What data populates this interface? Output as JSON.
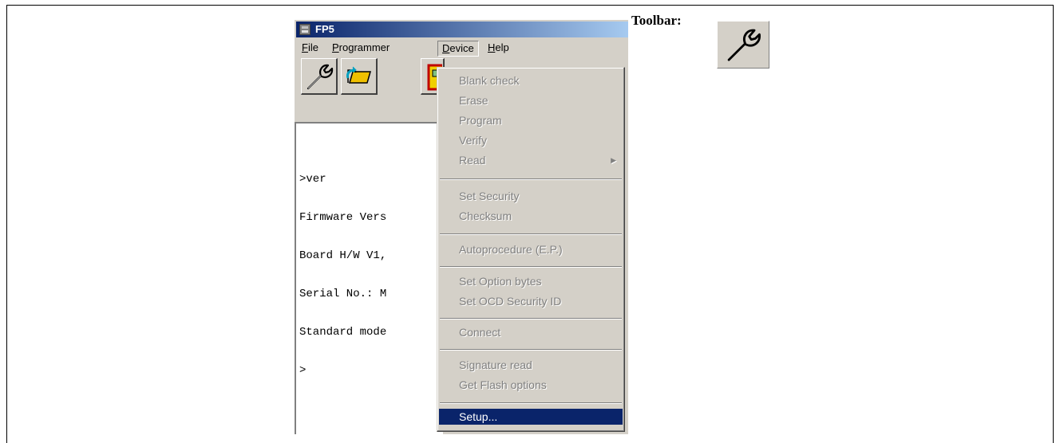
{
  "window": {
    "title": "FP5"
  },
  "menubar": [
    {
      "label": "File",
      "mnemonic": "F"
    },
    {
      "label": "Programmer",
      "mnemonic": "P"
    },
    {
      "label": "Device",
      "mnemonic": "D"
    },
    {
      "label": "Help",
      "mnemonic": "H"
    }
  ],
  "toolbar": {
    "icons": [
      "wrench-icon",
      "open-folder-icon",
      "device-program-icon"
    ]
  },
  "console": {
    "lines": [
      ">ver",
      "Firmware Vers",
      "Board H/W V1,",
      "Serial No.: M",
      "Standard mode",
      ">"
    ]
  },
  "device_menu": {
    "items": [
      {
        "label": "Blank check",
        "enabled": false
      },
      {
        "label": "Erase",
        "enabled": false
      },
      {
        "label": "Program",
        "enabled": false
      },
      {
        "label": "Verify",
        "enabled": false
      },
      {
        "label": "Read",
        "enabled": false,
        "submenu": true
      },
      {
        "label": "Set Security",
        "enabled": false
      },
      {
        "label": "Checksum",
        "enabled": false
      },
      {
        "label": "Autoprocedure (E.P.)",
        "enabled": false
      },
      {
        "label": "Set Option bytes",
        "enabled": false
      },
      {
        "label": "Set OCD Security ID",
        "enabled": false
      },
      {
        "label": "Connect",
        "enabled": false
      },
      {
        "label": "Signature read",
        "enabled": false
      },
      {
        "label": "Get Flash options",
        "enabled": false
      },
      {
        "label": "Setup...",
        "enabled": true,
        "highlighted": true
      }
    ]
  },
  "annotation": {
    "label": "Toolbar:",
    "icon": "wrench-icon"
  },
  "colors": {
    "title_bar": "#0a246a",
    "highlight": "#0a246a",
    "face": "#d4d0c8"
  }
}
